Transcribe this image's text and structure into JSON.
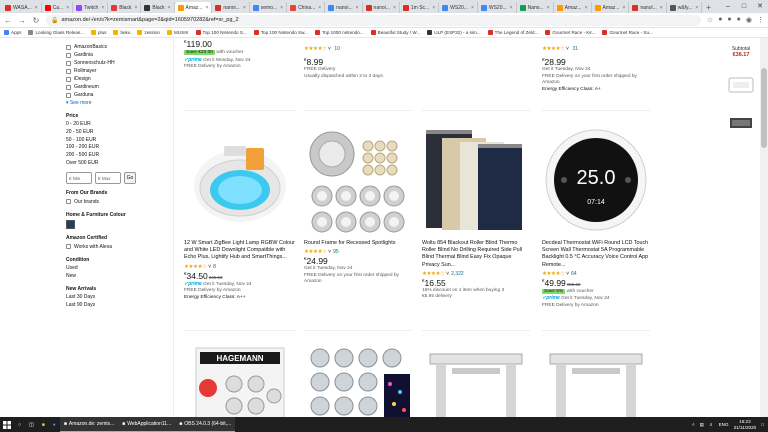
{
  "browser": {
    "tabs": [
      {
        "label": "WASA...",
        "color": "#d93025"
      },
      {
        "label": "Ca...",
        "color": "#ff0000"
      },
      {
        "label": "Twitch",
        "color": "#9146ff"
      },
      {
        "label": "Black",
        "color": "#e53935"
      },
      {
        "label": "Black",
        "color": "#333333"
      },
      {
        "label": "Amaz...",
        "color": "#ff9900",
        "active": true
      },
      {
        "label": "nanoi...",
        "color": "#d93025"
      },
      {
        "label": "semo...",
        "color": "#4285f4"
      },
      {
        "label": "China...",
        "color": "#ea4335"
      },
      {
        "label": "nanoi...",
        "color": "#4285f4"
      },
      {
        "label": "nanoi...",
        "color": "#d93025"
      },
      {
        "label": "1m Sc...",
        "color": "#d93025"
      },
      {
        "label": "WS20...",
        "color": "#4285f4"
      },
      {
        "label": "WS20...",
        "color": "#4285f4"
      },
      {
        "label": "Nano...",
        "color": "#0f9d58"
      },
      {
        "label": "Amaz...",
        "color": "#ff9900"
      },
      {
        "label": "Amaz...",
        "color": "#ff9900"
      },
      {
        "label": "nanol...",
        "color": "#d93025"
      },
      {
        "label": "w&fy...",
        "color": "#555555"
      }
    ],
    "url": "amazon.de/-/en/s?k=zemismart&page=2&qid=1605970282&ref=sr_pg_2",
    "bookmarks": [
      {
        "label": "Apps",
        "color": "#4285f4"
      },
      {
        "label": "Looking Glass Releas...",
        "color": "#888888"
      },
      {
        "label": "plus",
        "color": "#f4b400"
      },
      {
        "label": "beku",
        "color": "#f4b400"
      },
      {
        "label": "zession",
        "color": "#f4b400"
      },
      {
        "label": "MUSIK",
        "color": "#f4b400"
      },
      {
        "label": "Top 100 Nintendo S...",
        "color": "#d93025"
      },
      {
        "label": "Top 100 Nintendo Sw...",
        "color": "#d93025"
      },
      {
        "label": "Top 1000 nintendo...",
        "color": "#d93025"
      },
      {
        "label": "Beautiful Study / W...",
        "color": "#d93025"
      },
      {
        "label": "ULP (ESP32) - a sim...",
        "color": "#333333"
      },
      {
        "label": "The Legend of Zeld...",
        "color": "#d93025"
      },
      {
        "label": "Gourmet Race - Kir...",
        "color": "#d93025"
      },
      {
        "label": "Gourmet Race - Su...",
        "color": "#d93025"
      }
    ]
  },
  "filters": {
    "brands": [
      "AmazonBasics",
      "Gardinia",
      "Sonnenschutz-HH",
      "Rollmayer",
      "iDesign",
      "Gardineum",
      "Garduna"
    ],
    "see_more": "See more",
    "price_heading": "Price",
    "price_ranges": [
      "0 - 20 EUR",
      "20 - 50 EUR",
      "50 - 100 EUR",
      "100 - 200 EUR",
      "200 - 500 EUR",
      "Over 500 EUR"
    ],
    "min_placeholder": "€ Min",
    "max_placeholder": "€ Max",
    "go": "Go",
    "from_our_brands": "From Our Brands",
    "our_brands": "Our brands",
    "home_colour": "Home & Furniture Colour",
    "swatch_color": "#1e3f66",
    "amazon_certified": "Amazon Certified",
    "works_with_alexa": "Works with Alexa",
    "condition": "Condition",
    "conditions": [
      "Used",
      "New"
    ],
    "new_arrivals": "New Arrivals",
    "arrivals": [
      "Last 30 Days",
      "Last 90 Days"
    ]
  },
  "top_row": {
    "p1": {
      "price": "119.00",
      "badge": "Save €20.00",
      "badge_suffix": "with voucher",
      "prime_text": "Get it Monday, Nov 24",
      "delivery": "FREE Delivery by Amazon",
      "rating_count": "10"
    },
    "p2": {
      "price": "8.99",
      "delivery": "FREE Delivery",
      "dispatch": "Usually dispatched within 2 to 3 days."
    },
    "p3": {
      "price": "28.99",
      "get_it": "Get it Tuesday, Nov 24",
      "delivery": "FREE Delivery on your first order shipped by Amazon",
      "energy": "Energy Efficiency Class: A+",
      "rating_count": "31"
    }
  },
  "products": [
    {
      "title": "12 W Smart ZigBee Light Lamp RGBW Colour and White LED Downlight Compatible with Echo Plus, Lightify Hub and SmartThings...",
      "rating_count": "8",
      "price": "34.50",
      "was": "€45.50",
      "prime_text": "Get it Tuesday, Nov 24",
      "delivery": "FREE Delivery by Amazon",
      "energy": "Energy Efficiency Class: A++"
    },
    {
      "title": "Round Frame for Recessed Spotlights",
      "rating_count": "95",
      "price": "24.99",
      "get_it": "Get it Tuesday, Nov 24",
      "delivery": "FREE Delivery on your first order shipped by Amazon"
    },
    {
      "title": "Woltu 854 Blackout Roller Blind Thermo Roller Blind No Drilling Required Side Pull Blind Thermal Blind Easy Fix Opaque Privacy Sun...",
      "rating_count": "2,322",
      "price": "16.55",
      "discount": "15% discount on 1 item when buying 3",
      "delivery": "€5.95 delivery"
    },
    {
      "title": "Decdeal Thermostat WiFi Round LCD Touch Screen Wall Thermostat 5A Programmable Backlight 0.5 °C Accuracy Voice Control App Remote...",
      "rating_count": "64",
      "price": "49.99",
      "was": "€55.22",
      "badge": "Save 5%",
      "badge_suffix": "with voucher",
      "prime_text": "Get it Tuesday, Nov 24",
      "delivery": "FREE Delivery by Amazon"
    }
  ],
  "thermostat_display": {
    "temp": "25.0",
    "set": "07:14"
  },
  "hagemann_label": "HAGEMANN",
  "right": {
    "subtotal": "Subtotal",
    "price": "€36.17"
  },
  "taskbar": {
    "apps": [
      {
        "label": "Amazon.de: zemis...",
        "open": true
      },
      {
        "label": "WebApplication11...",
        "open": true
      },
      {
        "label": "OBS 24.0.3 (64-bit,...",
        "open": true
      }
    ],
    "lang": "ENG",
    "time": "16:23",
    "date": "21/11/2020"
  }
}
